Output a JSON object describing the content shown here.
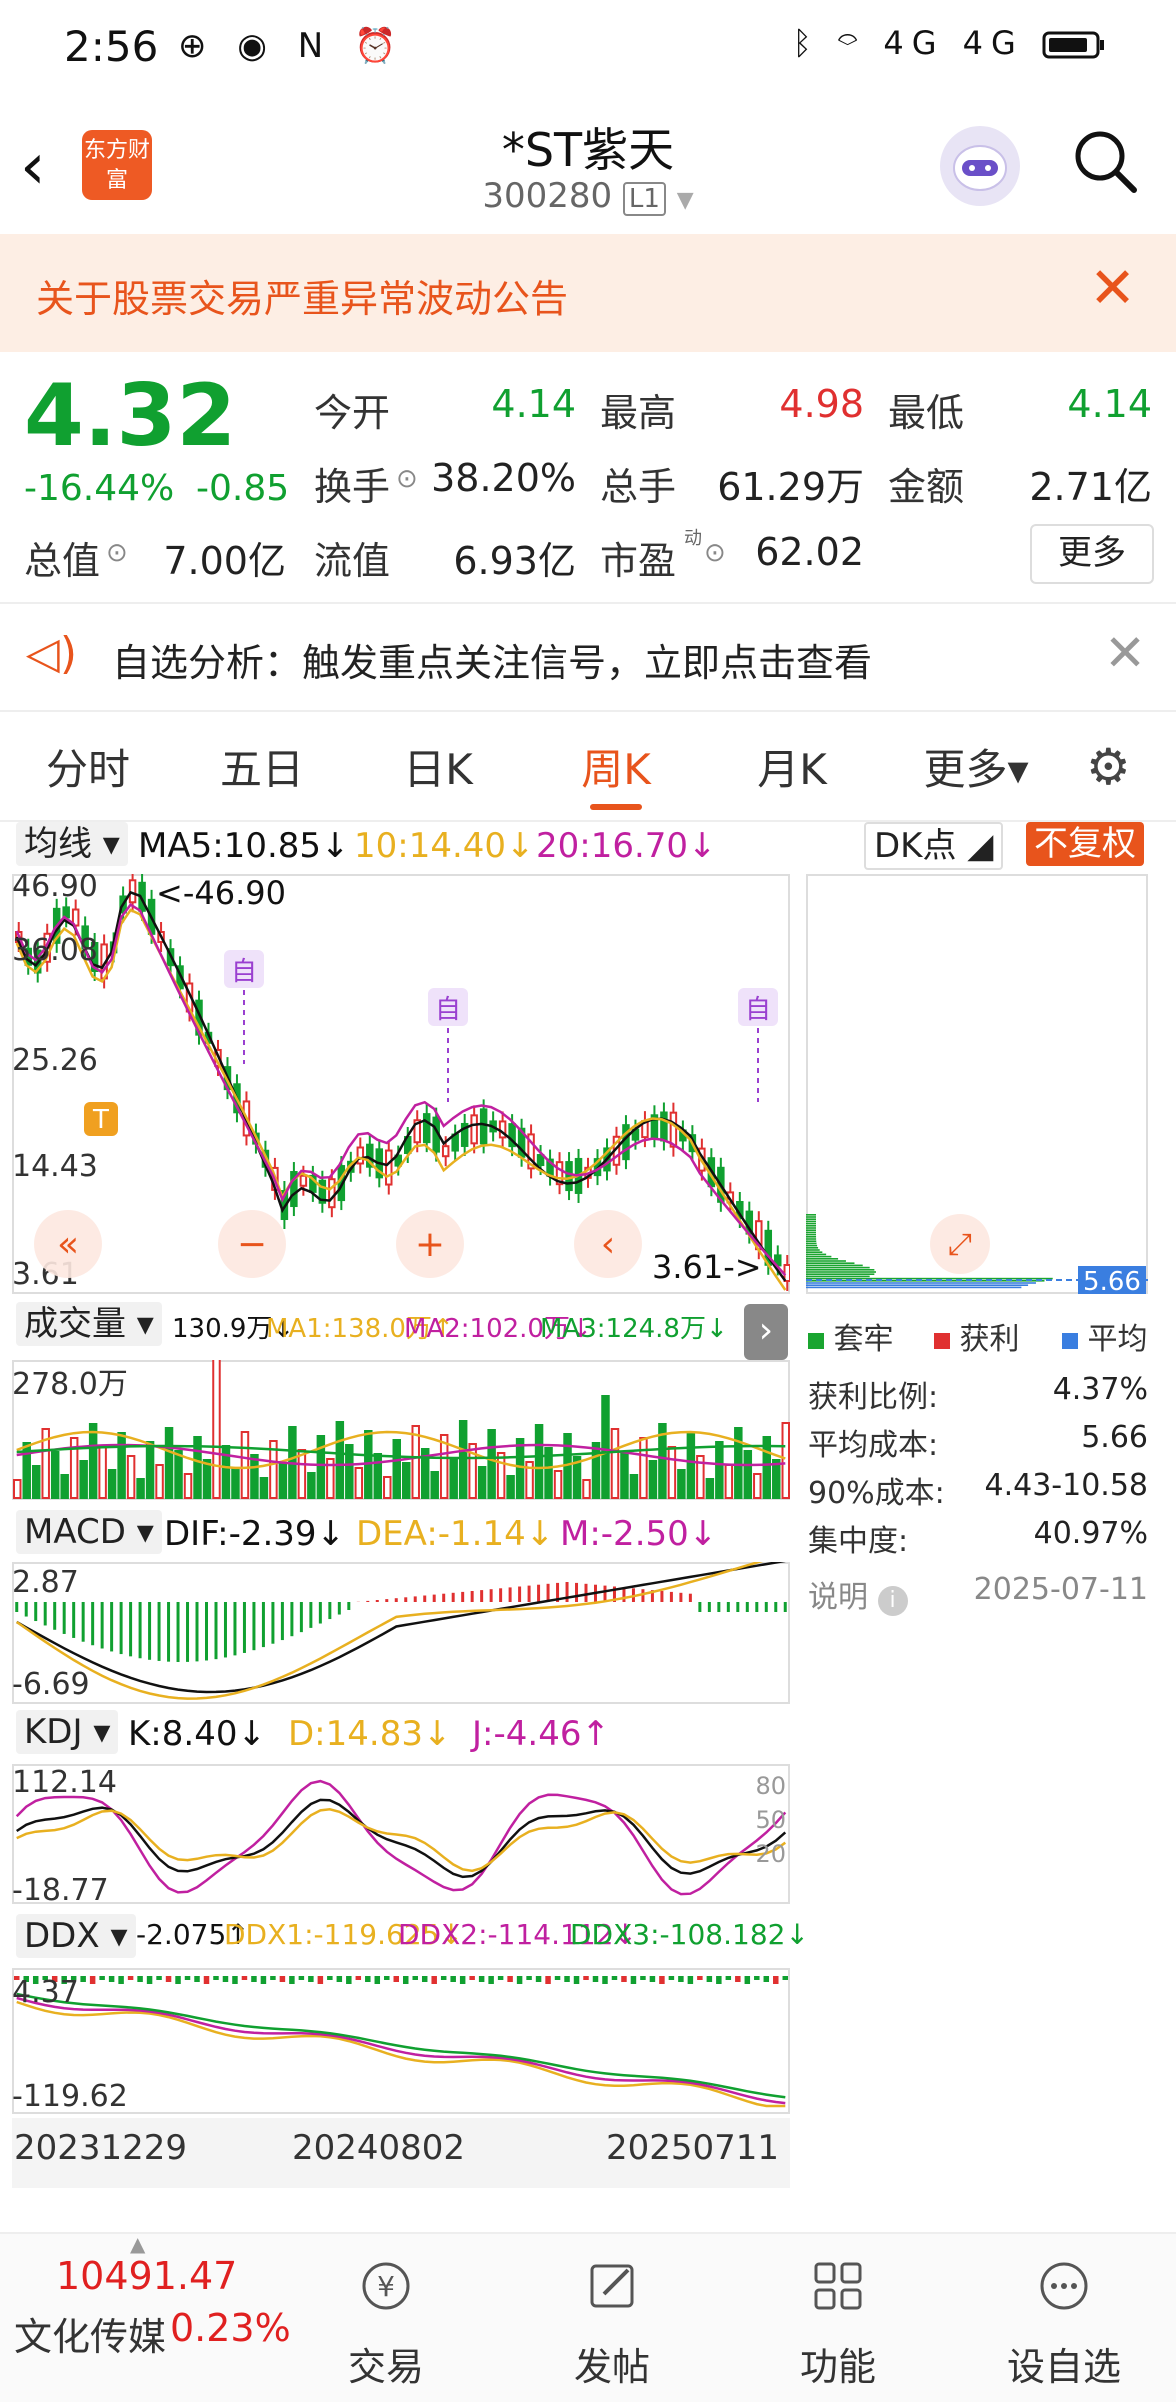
{
  "status_bar": {
    "time": "2:56",
    "left_icons": "⊕ ◉ N ⏰",
    "right_icons": "ᛒ ⌔ 4G 4G"
  },
  "header": {
    "back": "‹",
    "logo_text": "东方财富",
    "stock_name": "*ST紫天",
    "stock_code": "300280",
    "level": "L1"
  },
  "notice": {
    "text": "关于股票交易严重异常波动公告",
    "close": "✕"
  },
  "quote": {
    "price": "4.32",
    "change_pct": "-16.44%",
    "change": "-0.85",
    "open_label": "今开",
    "open": "4.14",
    "high_label": "最高",
    "high": "4.98",
    "low_label": "最低",
    "low": "4.14",
    "turnover_label": "换手",
    "turnover": "38.20%",
    "volume_label": "总手",
    "volume": "61.29万",
    "amount_label": "金额",
    "amount": "2.71亿",
    "mcap_label": "总值",
    "mcap": "7.00亿",
    "float_label": "流值",
    "float": "6.93亿",
    "pe_label": "市盈",
    "pe_sup": "动",
    "pe": "62.02",
    "more_button": "更多"
  },
  "analysis": {
    "text": "自选分析：触发重点关注信号，立即点击查看",
    "close": "✕"
  },
  "tabs": [
    {
      "label": "分时"
    },
    {
      "label": "五日"
    },
    {
      "label": "日K"
    },
    {
      "label": "周K"
    },
    {
      "label": "月K"
    },
    {
      "label": "更多▾"
    }
  ],
  "active_tab": "周K",
  "main_chart": {
    "selector": "均线",
    "ma5": "MA5:10.85↓",
    "ma10": "10:14.40↓",
    "ma20": "20:16.70↓",
    "dk_button": "DK点",
    "fq_button": "不复权",
    "y_labels": [
      "46.90",
      "36.08",
      "25.26",
      "14.43",
      "3.61"
    ],
    "max_label": "<-46.90",
    "min_label": "3.61->",
    "markers": [
      "自",
      "自",
      "自"
    ],
    "t_marker": "T"
  },
  "chip": {
    "cost_tag": "5.66",
    "legend": [
      {
        "label": "套牢",
        "color": "#1aa530"
      },
      {
        "label": "获利",
        "color": "#e03030"
      },
      {
        "label": "平均",
        "color": "#3a7ee0"
      }
    ],
    "rows": [
      {
        "label": "获利比例:",
        "value": "4.37%"
      },
      {
        "label": "平均成本:",
        "value": "5.66"
      },
      {
        "label": "90%成本:",
        "value": "4.43-10.58"
      },
      {
        "label": "集中度:",
        "value": "40.97%"
      }
    ],
    "note_label": "说明",
    "date": "2025-07-11"
  },
  "volume_chart": {
    "selector": "成交量",
    "cur": "130.9万↓",
    "ma1": "MA1:138.0万↑",
    "ma2": "MA2:102.0万↓",
    "ma3": "MA3:124.8万↓",
    "max_label": "278.0万"
  },
  "macd_chart": {
    "selector": "MACD",
    "dif": "DIF:-2.39↓",
    "dea": "DEA:-1.14↓",
    "m": "M:-2.50↓",
    "top": "2.87",
    "bottom": "-6.69"
  },
  "kdj_chart": {
    "selector": "KDJ",
    "k": "K:8.40↓",
    "d": "D:14.83↓",
    "j": "J:-4.46↑",
    "top": "112.14",
    "bottom": "-18.77",
    "levels": [
      "80",
      "50",
      "20"
    ]
  },
  "ddx_chart": {
    "selector": "DDX",
    "ddx": "-2.075↑",
    "ddx1": "DDX1:-119.625↓",
    "ddx2": "DDX2:-114.112↓",
    "ddx3": "DDX3:-108.182↓",
    "top": "4.37",
    "bottom": "-119.62"
  },
  "x_dates": [
    "20231229",
    "20240802",
    "20250711"
  ],
  "bottom_nav": {
    "index_value": "10491.47",
    "index_name": "文化传媒",
    "index_pct": "0.23%",
    "items": [
      {
        "label": "交易"
      },
      {
        "label": "发帖"
      },
      {
        "label": "功能"
      },
      {
        "label": "设自选"
      }
    ]
  },
  "colors": {
    "up": "#e03030",
    "down": "#10a030",
    "accent": "#e8541c",
    "ma5": "#111111",
    "ma10": "#e8b020",
    "ma20": "#c020a0"
  }
}
